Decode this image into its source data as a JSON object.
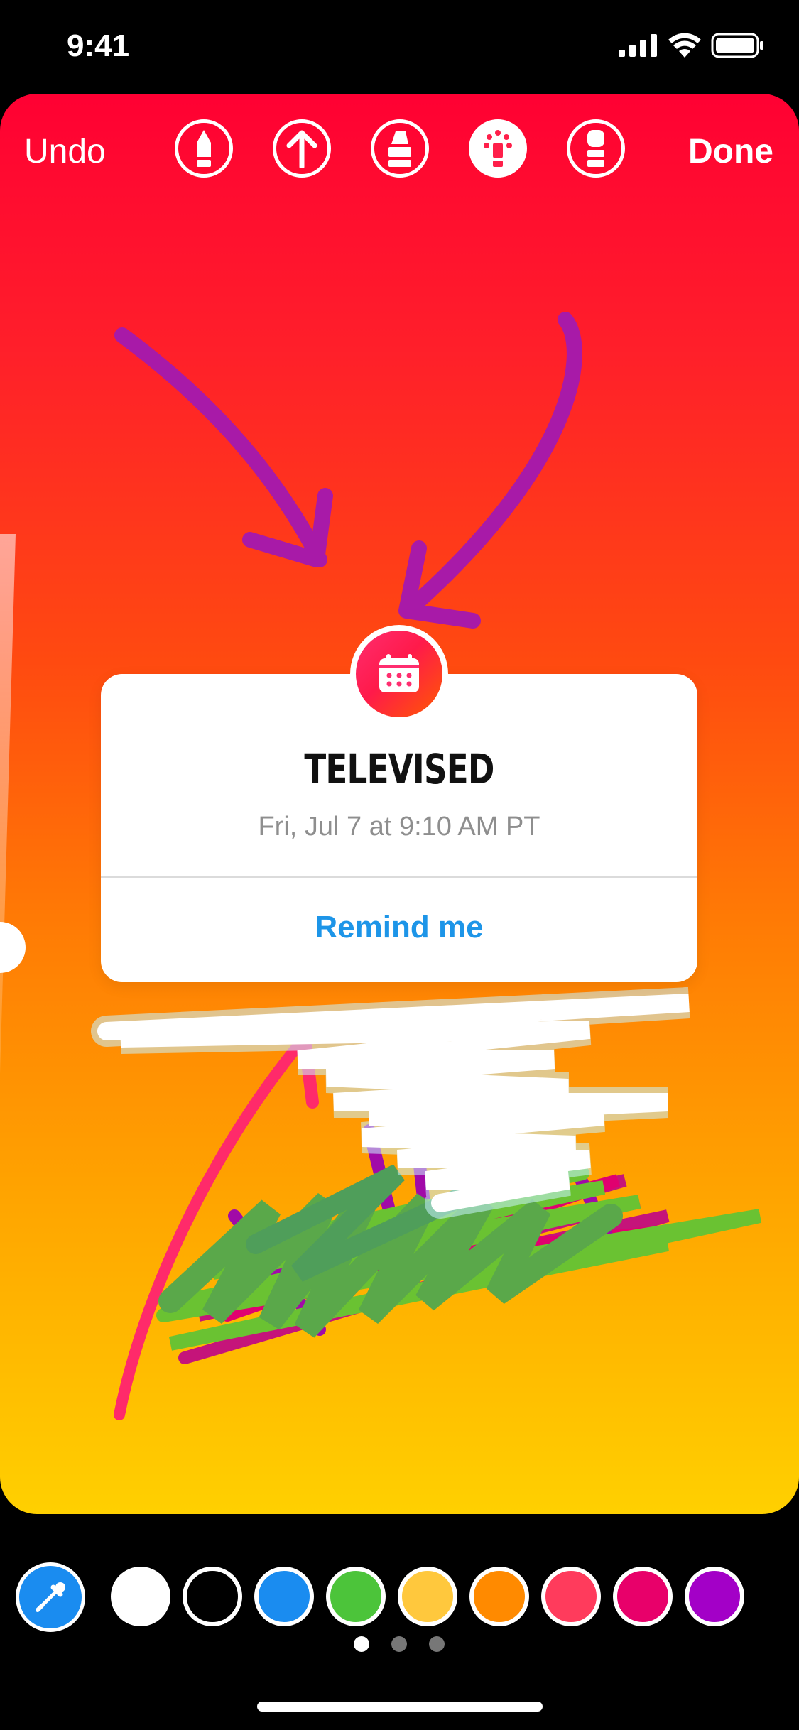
{
  "status_bar": {
    "time": "9:41"
  },
  "toolbar": {
    "undo_label": "Undo",
    "done_label": "Done",
    "tools": [
      "pen-tool-icon",
      "arrow-tool-icon",
      "marker-tool-icon",
      "neon-tool-icon",
      "eraser-tool-icon"
    ]
  },
  "sticker": {
    "title": "TELEVISED",
    "date": "Fri, Jul 7 at 9:10 AM PT",
    "action": "Remind me",
    "icon": "calendar-icon"
  },
  "palette": {
    "colors": [
      "#ffffff",
      "#000000",
      "#1a8cf0",
      "#4cc43a",
      "#ffc83d",
      "#ff8a00",
      "#ff3b5c",
      "#e8006a",
      "#a300c7"
    ],
    "page_count": 3,
    "active_page": 1
  }
}
